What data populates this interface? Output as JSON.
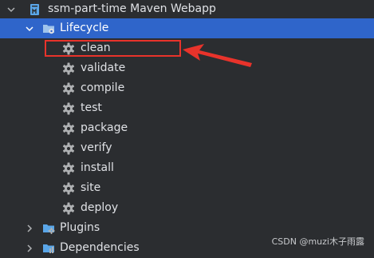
{
  "project": {
    "name": "ssm-part-time Maven Webapp",
    "icon": "maven-project-icon"
  },
  "lifecycle": {
    "label": "Lifecycle",
    "icon": "lifecycle-folder-icon",
    "tasks": [
      {
        "label": "clean",
        "icon": "gear-icon"
      },
      {
        "label": "validate",
        "icon": "gear-icon"
      },
      {
        "label": "compile",
        "icon": "gear-icon"
      },
      {
        "label": "test",
        "icon": "gear-icon"
      },
      {
        "label": "package",
        "icon": "gear-icon"
      },
      {
        "label": "verify",
        "icon": "gear-icon"
      },
      {
        "label": "install",
        "icon": "gear-icon"
      },
      {
        "label": "site",
        "icon": "gear-icon"
      },
      {
        "label": "deploy",
        "icon": "gear-icon"
      }
    ]
  },
  "plugins": {
    "label": "Plugins",
    "icon": "plugins-folder-icon"
  },
  "dependencies": {
    "label": "Dependencies",
    "icon": "dependencies-folder-icon"
  },
  "watermark": "CSDN @muzi木子雨露",
  "colors": {
    "background": "#2b2d30",
    "selection": "#2f65ca",
    "annotation": "#e8332b",
    "text": "#dfe1e5",
    "icon_gray": "#afb1b3",
    "folder_blue": "#5aa6e8"
  }
}
